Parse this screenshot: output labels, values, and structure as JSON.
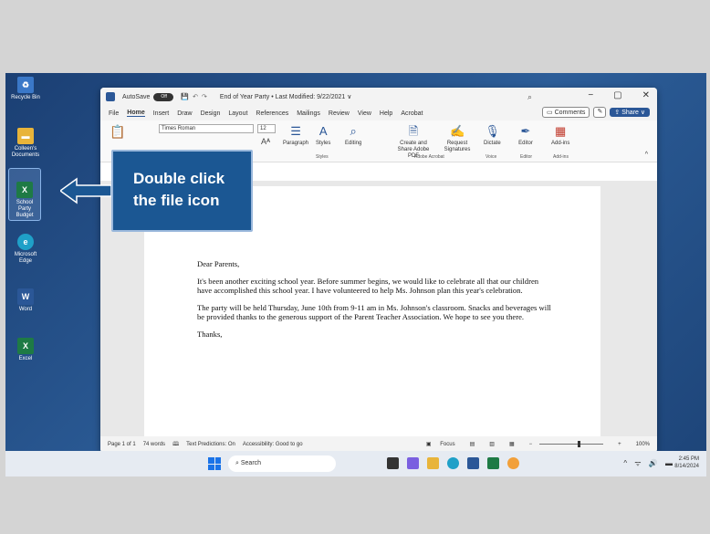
{
  "desktop": {
    "icons": [
      {
        "label": "Recycle Bin",
        "color": "#3a78c8",
        "glyph": "♻"
      },
      {
        "label": "Colleen's Documents",
        "color": "#e8b43a",
        "glyph": "▬"
      },
      {
        "label": "School Party Budget",
        "color": "#1e7a45",
        "glyph": "X"
      },
      {
        "label": "Microsoft Edge",
        "color": "#1fa0c8",
        "glyph": "e"
      },
      {
        "label": "Word",
        "color": "#2b5797",
        "glyph": "W"
      },
      {
        "label": "Excel",
        "color": "#1e7a45",
        "glyph": "X"
      }
    ]
  },
  "word": {
    "autosave_label": "AutoSave",
    "autosave_state": "Off",
    "doc_title": "End of Year Party • Last Modified: 9/22/2021 ∨",
    "menu_tabs": [
      "File",
      "Home",
      "Insert",
      "Draw",
      "Design",
      "Layout",
      "References",
      "Mailings",
      "Review",
      "View",
      "Help",
      "Acrobat"
    ],
    "active_tab": "Home",
    "comments_label": "Comments",
    "share_label": "Share",
    "font_name": "Times Roman",
    "font_size": "12",
    "ribbon": {
      "paragraph": "Paragraph",
      "styles": "Styles",
      "editing": "Editing",
      "create_share": "Create and Share Adobe PDF",
      "request_signatures": "Request Signatures",
      "dictate": "Dictate",
      "editor": "Editor",
      "addins": "Add-ins",
      "group_styles": "Styles",
      "group_adobe": "Adobe Acrobat",
      "group_voice": "Voice",
      "group_editor": "Editor",
      "group_addins": "Add-ins"
    },
    "document": {
      "salutation": "Dear Parents,",
      "para1": "It's been another exciting school year. Before summer begins, we would like to celebrate all that our children have accomplished this school year. I have volunteered to help Ms. Johnson plan this year's celebration.",
      "para2": "The party will be held Thursday, June 10th from 9-11 am in Ms. Johnson's classroom. Snacks and beverages will be provided thanks to the generous support of the Parent Teacher Association. We hope to see you there.",
      "closing": "Thanks,"
    },
    "status": {
      "page": "Page 1 of 1",
      "words": "74 words",
      "text_predictions": "Text Predictions: On",
      "accessibility": "Accessibility: Good to go",
      "focus": "Focus",
      "zoom": "100%"
    }
  },
  "callout": {
    "line1": "Double click",
    "line2": "the file icon"
  },
  "taskbar": {
    "search_placeholder": "Search",
    "time": "2:45 PM",
    "date": "8/14/2024"
  }
}
